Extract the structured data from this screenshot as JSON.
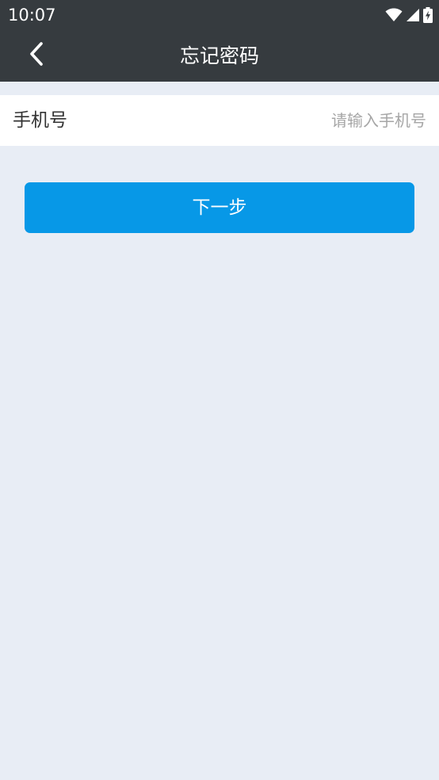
{
  "status_bar": {
    "time": "10:07",
    "icons": [
      "wifi-icon",
      "signal-icon",
      "battery-charging-icon"
    ]
  },
  "app_bar": {
    "back_icon": "chevron-left-icon",
    "title": "忘记密码"
  },
  "form": {
    "phone_label": "手机号",
    "phone_value": "",
    "phone_placeholder": "请输入手机号",
    "next_label": "下一步"
  },
  "colors": {
    "header_bg": "#363b3f",
    "page_bg": "#e8edf5",
    "primary": "#0798e7",
    "placeholder": "#a6a6a6"
  }
}
